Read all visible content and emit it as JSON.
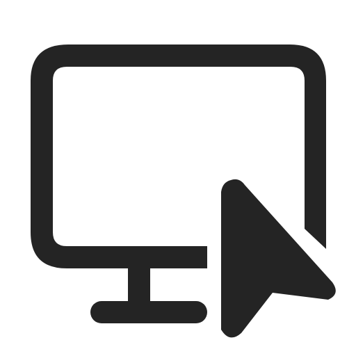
{
  "icon": {
    "name": "desktop-cursor-icon",
    "parts": [
      "monitor-icon",
      "cursor-arrow-icon"
    ]
  },
  "colors": {
    "background": "#ffffff",
    "foreground": "#242424"
  }
}
